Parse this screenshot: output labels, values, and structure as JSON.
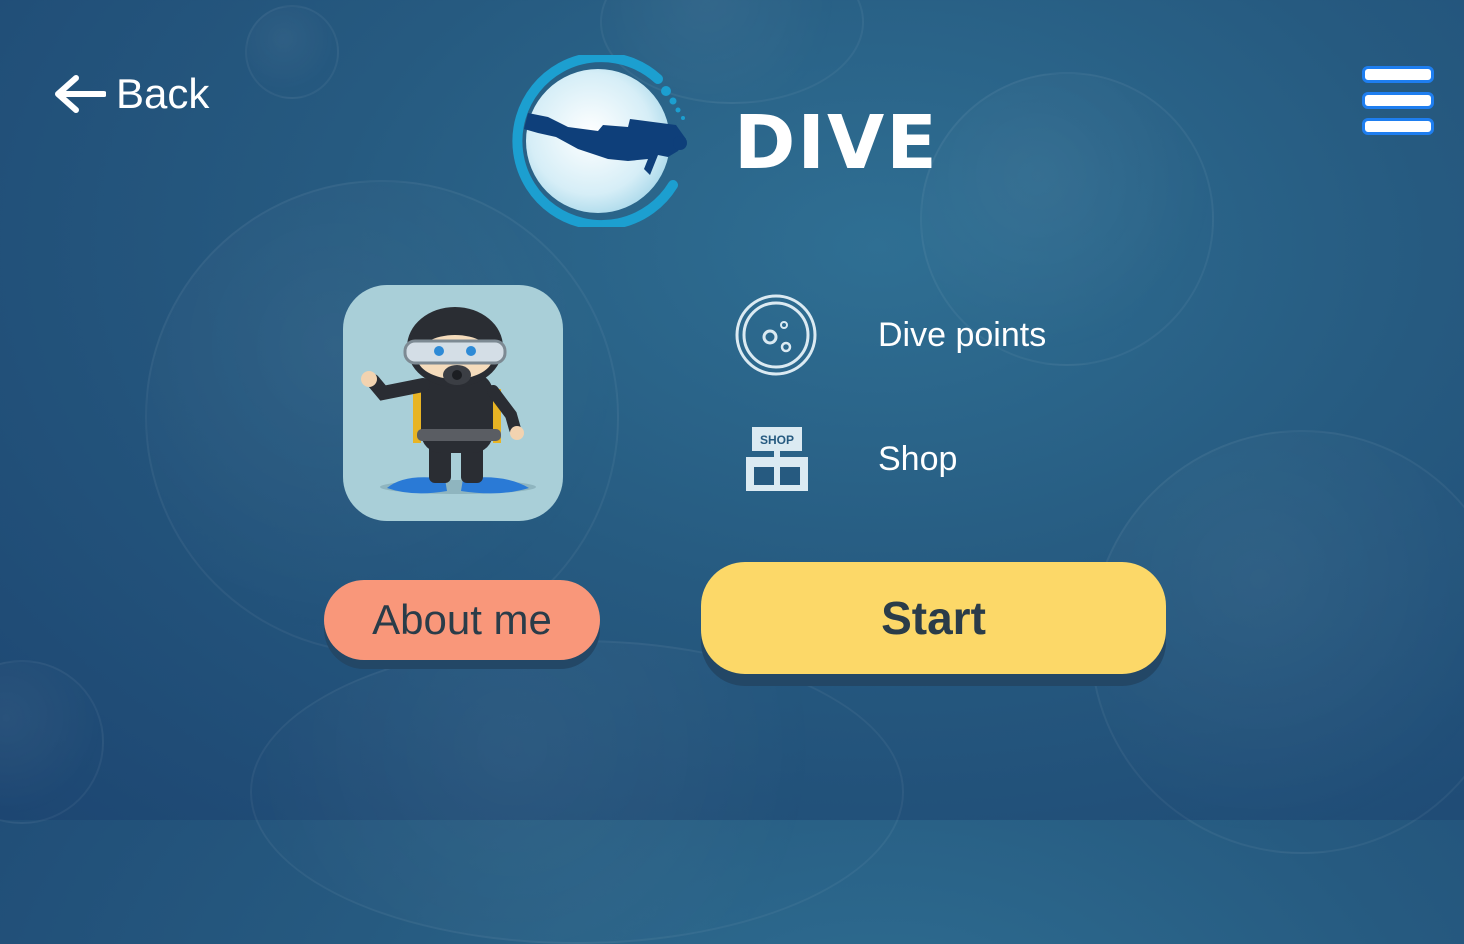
{
  "nav": {
    "back_label": "Back",
    "back_icon": "arrow-left-icon",
    "menu_icon": "hamburger-menu-icon"
  },
  "app": {
    "title": "DIVE",
    "logo_icon": "scuba-diver-logo-icon"
  },
  "profile": {
    "avatar_icon": "diver-avatar"
  },
  "menu_items": [
    {
      "label": "Dive points",
      "icon": "bubbles-icon"
    },
    {
      "label": "Shop",
      "icon": "shop-icon",
      "icon_text": "SHOP"
    }
  ],
  "buttons": {
    "about_label": "About me",
    "start_label": "Start"
  },
  "colors": {
    "background": "#265a80",
    "about_button": "#f9977a",
    "start_button": "#fcd868",
    "logo_accent": "#1c9fd0",
    "menu_outline": "#1e7ef0"
  }
}
